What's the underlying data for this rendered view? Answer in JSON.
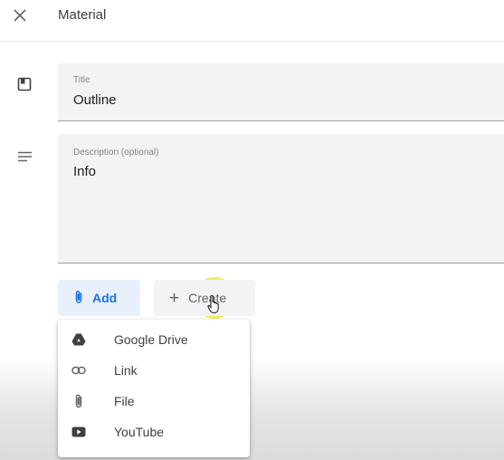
{
  "header": {
    "title": "Material"
  },
  "form": {
    "title": {
      "label": "Title",
      "value": "Outline"
    },
    "description": {
      "label": "Description (optional)",
      "value": "Info"
    }
  },
  "actions": {
    "add_label": "Add",
    "create_label": "Create"
  },
  "add_menu": {
    "items": [
      {
        "label": "Google Drive",
        "icon": "google-drive-icon"
      },
      {
        "label": "Link",
        "icon": "link-icon"
      },
      {
        "label": "File",
        "icon": "paperclip-icon"
      },
      {
        "label": "YouTube",
        "icon": "youtube-icon"
      }
    ]
  },
  "colors": {
    "accent": "#1a73e8",
    "accent_bg": "#e8f0fe",
    "field_bg": "#f1f3f4",
    "highlight": "#f0e828"
  }
}
